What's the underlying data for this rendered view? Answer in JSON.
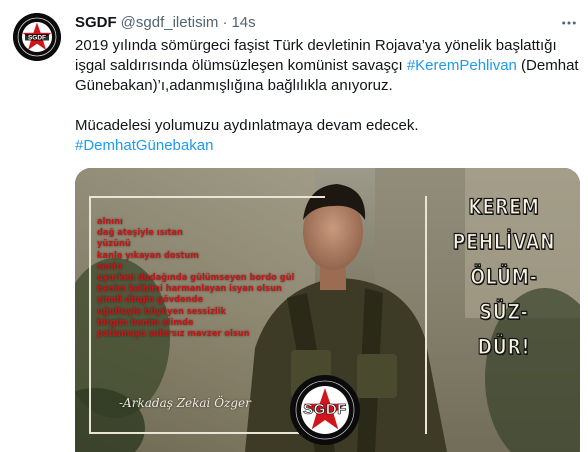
{
  "tweet": {
    "display_name": "SGDF",
    "handle": "@sgdf_iletisim",
    "separator": "·",
    "time": "14s",
    "paragraph1_text1": "2019 yılında sömürgeci faşist Türk devletinin Rojava’ya yönelik başlattığı işgal saldırısında ölümsüzleşen komünist savaşçı ",
    "paragraph1_hashtag": "#KeremPehlivan",
    "paragraph1_text2": " (Demhat Günebakan)’ı,adanmışlığına bağlılıkla anıyoruz.",
    "paragraph2_text": "Mücadelesi yolumuzu aydınlatmaya devam edecek.",
    "paragraph2_hashtag": "#DemhatGünebakan"
  },
  "media": {
    "poem_lines": [
      "alnını",
      "dağ ateşiyle ısıtan",
      "yüzünü",
      "kanla yıkayan dostum",
      "senin",
      "uyurken dudağında gülümseyen bordo gül",
      "benim kalbimi harmanlayan isyan olsun",
      "şimdi dingin gövdende",
      "uğultuyla büyüyen sessizlik",
      "birgün benim elimde",
      "patlamaya sabırsız mavzer olsun"
    ],
    "poem_signature": "-Arkadaş Zekai Özger",
    "side_lines": [
      "KEREM",
      "PEHLİVAN",
      "ÖLÜM-",
      "SÜZ-",
      "DÜR!"
    ],
    "logo_text": "SGDF"
  },
  "colors": {
    "accent": "#1d9bf0",
    "text": "#0f1419",
    "secondary": "#536471",
    "poem": "#c41818",
    "logo_red": "#d0161c"
  },
  "icons": {
    "avatar": "sgdf-star-logo",
    "more": "more-horizontal-icon",
    "media_logo": "sgdf-badge-icon"
  }
}
